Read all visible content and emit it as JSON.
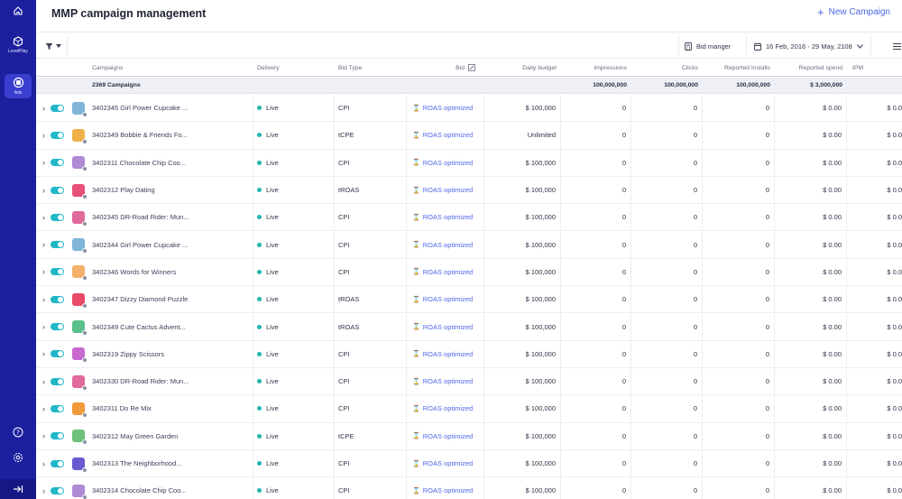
{
  "rail": {
    "items": [
      {
        "icon": "home-icon",
        "label": ""
      },
      {
        "icon": "levelplay-icon",
        "label": "LevelPlay"
      },
      {
        "icon": "ads-icon",
        "label": "Ads"
      }
    ],
    "bottom": [
      {
        "icon": "help-icon"
      },
      {
        "icon": "settings-icon"
      }
    ],
    "collapse_icon": "expand-sidebar-icon"
  },
  "header": {
    "title": "MMP campaign management",
    "new_campaign_label": "New Campaign"
  },
  "toolbar": {
    "bid_manager_label": "Bid manger",
    "date_range": "16 Feb, 2016 - 29 May, 2108"
  },
  "table": {
    "columns": {
      "campaigns": "Campaigns",
      "delivery": "Delivery",
      "bid_type": "Bid Type",
      "bid": "Bid",
      "daily_budget": "Daily budget",
      "impressions": "Impressions",
      "clicks": "Clicks",
      "reported_installs": "Reported Installs",
      "reported_spend": "Reported spend",
      "ipm": "IPM"
    },
    "totals": {
      "label": "2369 Campaigns",
      "clicks": "100,000,000",
      "installs": "100,000,000",
      "spend": "100,000,000",
      "ipm": "$ 3,000,000"
    },
    "rows": [
      {
        "name": "3402345 Girl Power Cupcake ...",
        "delivery": "Live",
        "bid_type": "CPI",
        "bid": "ROAS optimized",
        "budget": "$ 100,000",
        "impressions": "0",
        "clicks": "0",
        "installs": "0",
        "spend": "$ 0.00",
        "ipm": "$ 0.0",
        "thumb": "#7fb5d9"
      },
      {
        "name": "3402349 Bobbie & Friends Fo...",
        "delivery": "Live",
        "bid_type": "tCPE",
        "bid": "ROAS optimized",
        "budget": "Unlimited",
        "impressions": "0",
        "clicks": "0",
        "installs": "0",
        "spend": "$ 0.00",
        "ipm": "$ 0.0",
        "thumb": "#f0b04a"
      },
      {
        "name": "3402311 Chocolate Chip Coo...",
        "delivery": "Live",
        "bid_type": "CPI",
        "bid": "ROAS optimized",
        "budget": "$ 100,000",
        "impressions": "0",
        "clicks": "0",
        "installs": "0",
        "spend": "$ 0.00",
        "ipm": "$ 0.0",
        "thumb": "#b18ad6"
      },
      {
        "name": "3402312 Play Dating",
        "delivery": "Live",
        "bid_type": "tROAS",
        "bid": "ROAS optimized",
        "budget": "$ 100,000",
        "impressions": "0",
        "clicks": "0",
        "installs": "0",
        "spend": "$ 0.00",
        "ipm": "$ 0.0",
        "thumb": "#e8507a"
      },
      {
        "name": "3402345 DR-Road Rider: Mun...",
        "delivery": "Live",
        "bid_type": "CPI",
        "bid": "ROAS optimized",
        "budget": "$ 100,000",
        "impressions": "0",
        "clicks": "0",
        "installs": "0",
        "spend": "$ 0.00",
        "ipm": "$ 0.0",
        "thumb": "#e06a9a"
      },
      {
        "name": "3402344 Girl Power Cupcake ...",
        "delivery": "Live",
        "bid_type": "CPI",
        "bid": "ROAS optimized",
        "budget": "$ 100,000",
        "impressions": "0",
        "clicks": "0",
        "installs": "0",
        "spend": "$ 0.00",
        "ipm": "$ 0.0",
        "thumb": "#7fb5d9"
      },
      {
        "name": "3402346 Words for Winners",
        "delivery": "Live",
        "bid_type": "CPI",
        "bid": "ROAS optimized",
        "budget": "$ 100,000",
        "impressions": "0",
        "clicks": "0",
        "installs": "0",
        "spend": "$ 0.00",
        "ipm": "$ 0.0",
        "thumb": "#f3b06a"
      },
      {
        "name": "3402347 Dizzy Diamond Puzzle",
        "delivery": "Live",
        "bid_type": "tROAS",
        "bid": "ROAS optimized",
        "budget": "$ 100,000",
        "impressions": "0",
        "clicks": "0",
        "installs": "0",
        "spend": "$ 0.00",
        "ipm": "$ 0.0",
        "thumb": "#e84a6a"
      },
      {
        "name": "3402349 Cute Cactus Advent...",
        "delivery": "Live",
        "bid_type": "tROAS",
        "bid": "ROAS optimized",
        "budget": "$ 100,000",
        "impressions": "0",
        "clicks": "0",
        "installs": "0",
        "spend": "$ 0.00",
        "ipm": "$ 0.0",
        "thumb": "#5cc08a"
      },
      {
        "name": "3402319 Zippy Scissors",
        "delivery": "Live",
        "bid_type": "CPI",
        "bid": "ROAS optimized",
        "budget": "$ 100,000",
        "impressions": "0",
        "clicks": "0",
        "installs": "0",
        "spend": "$ 0.00",
        "ipm": "$ 0.0",
        "thumb": "#c86ad0"
      },
      {
        "name": "3402330 DR-Road Rider: Mun...",
        "delivery": "Live",
        "bid_type": "CPI",
        "bid": "ROAS optimized",
        "budget": "$ 100,000",
        "impressions": "0",
        "clicks": "0",
        "installs": "0",
        "spend": "$ 0.00",
        "ipm": "$ 0.0",
        "thumb": "#e06a9a"
      },
      {
        "name": "3402311 Do Re Mix",
        "delivery": "Live",
        "bid_type": "CPI",
        "bid": "ROAS optimized",
        "budget": "$ 100,000",
        "impressions": "0",
        "clicks": "0",
        "installs": "0",
        "spend": "$ 0.00",
        "ipm": "$ 0.0",
        "thumb": "#f09a3a"
      },
      {
        "name": "3402312 May Green Garden",
        "delivery": "Live",
        "bid_type": "tCPE",
        "bid": "ROAS optimized",
        "budget": "$ 100,000",
        "impressions": "0",
        "clicks": "0",
        "installs": "0",
        "spend": "$ 0.00",
        "ipm": "$ 0.0",
        "thumb": "#6ec07a"
      },
      {
        "name": "3402313 The Neighborhood...",
        "delivery": "Live",
        "bid_type": "CPI",
        "bid": "ROAS optimized",
        "budget": "$ 100,000",
        "impressions": "0",
        "clicks": "0",
        "installs": "0",
        "spend": "$ 0.00",
        "ipm": "$ 0.0",
        "thumb": "#6a5ad0"
      },
      {
        "name": "3402314 Chocolate Chip Coo...",
        "delivery": "Live",
        "bid_type": "CPI",
        "bid": "ROAS optimized",
        "budget": "$ 100,000",
        "impressions": "0",
        "clicks": "0",
        "installs": "0",
        "spend": "$ 0.00",
        "ipm": "$ 0.0",
        "thumb": "#b18ad6"
      }
    ]
  },
  "colors": {
    "rail": "#1c1f9e",
    "accent": "#4f67e8",
    "toggle_on": "#20b7c7",
    "live": "#22b5b0"
  }
}
